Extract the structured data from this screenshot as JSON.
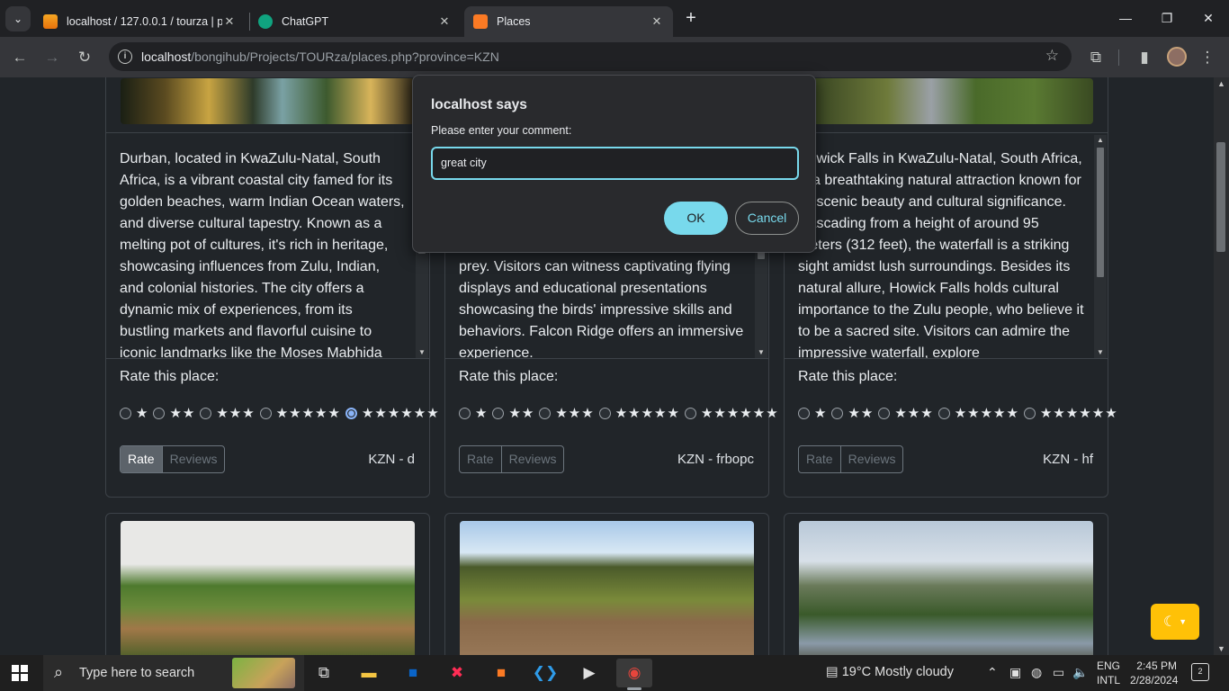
{
  "browser": {
    "tabs": [
      {
        "title": "localhost / 127.0.0.1 / tourza | p",
        "close": "✕",
        "favicon": "phpmyadmin-icon"
      },
      {
        "title": "ChatGPT",
        "close": "✕",
        "favicon": "chatgpt-icon"
      },
      {
        "title": "Places",
        "close": "✕",
        "favicon": "xampp-icon"
      }
    ],
    "new_tab": "+",
    "url_host": "localhost",
    "url_path": "/bongihub/Projects/TOURza/places.php?province=KZN"
  },
  "dialog": {
    "title": "localhost says",
    "message": "Please enter your comment:",
    "input_value": "great city",
    "ok_label": "OK",
    "cancel_label": "Cancel"
  },
  "rating_options": [
    "★",
    "★★",
    "★★★",
    "★★★★★",
    "★★★★★★"
  ],
  "cards": [
    {
      "description": "Durban, located in KwaZulu-Natal, South Africa, is a vibrant coastal city famed for its golden beaches, warm Indian Ocean waters, and diverse cultural tapestry. Known as a melting pot of cultures, it's rich in heritage, showcasing influences from Zulu, Indian, and colonial histories. The city offers a dynamic mix of experiences, from its bustling markets and flavorful cuisine to iconic landmarks like the Moses Mabhida",
      "rate_label": "Rate this place:",
      "selected_rating": 5,
      "btn_rate": "Rate",
      "btn_reviews": "Reviews",
      "code": "KZN - d"
    },
    {
      "description": "center houses a diverse collection of birds of prey. Visitors can witness captivating flying displays and educational presentations showcasing the birds' impressive skills and behaviors. Falcon Ridge offers an immersive experience.",
      "rate_label": "Rate this place:",
      "selected_rating": 0,
      "btn_rate": "Rate",
      "btn_reviews": "Reviews",
      "code": "KZN - frbopc"
    },
    {
      "description": "Howick Falls in KwaZulu-Natal, South Africa, is a breathtaking natural attraction known for its scenic beauty and cultural significance. Cascading from a height of around 95 meters (312 feet), the waterfall is a striking sight amidst lush surroundings. Besides its natural allure, Howick Falls holds cultural importance to the Zulu people, who believe it to be a sacred site. Visitors can admire the impressive waterfall, explore",
      "rate_label": "Rate this place:",
      "selected_rating": 0,
      "btn_rate": "Rate",
      "btn_reviews": "Reviews",
      "code": "KZN - hf"
    }
  ],
  "taskbar": {
    "search_placeholder": "Type here to search",
    "weather": "19°C  Mostly cloudy",
    "lang_1": "ENG",
    "lang_2": "INTL",
    "time": "2:45 PM",
    "date": "2/28/2024",
    "notif_count": "2"
  }
}
